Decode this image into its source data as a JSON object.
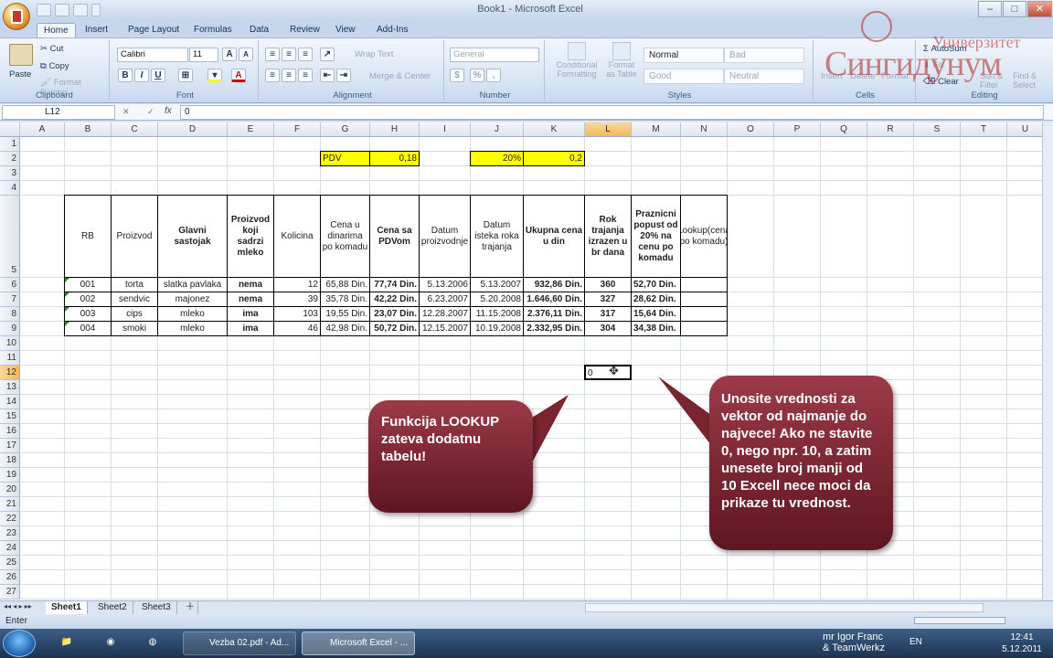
{
  "window": {
    "title": "Book1 - Microsoft Excel"
  },
  "tabs": [
    "Home",
    "Insert",
    "Page Layout",
    "Formulas",
    "Data",
    "Review",
    "View",
    "Add-Ins"
  ],
  "ribbon": {
    "clipboard": {
      "paste": "Paste",
      "cut": "Cut",
      "copy": "Copy",
      "format_painter": "Format Painter",
      "label": "Clipboard"
    },
    "font": {
      "name": "Calibri",
      "size": "11",
      "label": "Font",
      "bold": "B",
      "italic": "I",
      "underline": "U"
    },
    "alignment": {
      "wrap": "Wrap Text",
      "merge": "Merge & Center",
      "label": "Alignment"
    },
    "number": {
      "format": "General",
      "pct": "%",
      "comma": ",",
      "label": "Number"
    },
    "styles": {
      "cond": "Conditional Formatting",
      "table": "Format as Table",
      "normal": "Normal",
      "bad": "Bad",
      "good": "Good",
      "neutral": "Neutral",
      "label": "Styles"
    },
    "cells": {
      "insert": "Insert",
      "delete": "Delete",
      "format": "Format",
      "label": "Cells"
    },
    "editing": {
      "autosum": "AutoSum",
      "fill": "Fill",
      "clear": "Clear",
      "sort": "Sort & Filter",
      "find": "Find & Select",
      "label": "Editing"
    }
  },
  "formula_bar": {
    "name_box": "L12",
    "fx": "fx",
    "content": "0"
  },
  "columns": [
    "A",
    "B",
    "C",
    "D",
    "E",
    "F",
    "G",
    "H",
    "I",
    "J",
    "K",
    "L",
    "M",
    "N",
    "O",
    "P",
    "Q",
    "R",
    "S",
    "T",
    "U"
  ],
  "rows": [
    "1",
    "2",
    "3",
    "4",
    "5",
    "6",
    "7",
    "8",
    "9",
    "10",
    "11",
    "12",
    "13",
    "14",
    "15",
    "16",
    "17",
    "18",
    "19",
    "20",
    "21",
    "22",
    "23",
    "24",
    "25",
    "26",
    "27"
  ],
  "pdv": {
    "label": "PDV",
    "value": "0,18",
    "pct": "20%",
    "pct_value": "0,2"
  },
  "table": {
    "headers": [
      "RB",
      "Proizvod",
      "Glavni sastojak",
      "Proizvod koji sadrzi mleko",
      "Kolicina",
      "Cena u dinarima po komadu",
      "Cena sa PDVom",
      "Datum proizvodnje",
      "Datum isteka roka trajanja",
      "Ukupna cena u din",
      "Rok trajanja izrazen u br dana",
      "Praznicni popust od 20% na cenu po komadu",
      "Lookup(cena po komadu)"
    ],
    "rows": [
      [
        "001",
        "torta",
        "slatka pavlaka",
        "nema",
        "12",
        "65,88 Din.",
        "77,74 Din.",
        "5.13.2006",
        "5.13.2007",
        "932,86 Din.",
        "360",
        "52,70 Din.",
        ""
      ],
      [
        "002",
        "sendvic",
        "majonez",
        "nema",
        "39",
        "35,78 Din.",
        "42,22 Din.",
        "6.23.2007",
        "5.20.2008",
        "1.646,60 Din.",
        "327",
        "28,62 Din.",
        ""
      ],
      [
        "003",
        "cips",
        "mleko",
        "ima",
        "103",
        "19,55 Din.",
        "23,07 Din.",
        "12.28.2007",
        "11.15.2008",
        "2.376,11 Din.",
        "317",
        "15,64 Din.",
        ""
      ],
      [
        "004",
        "smoki",
        "mleko",
        "ima",
        "46",
        "42,98 Din.",
        "50,72 Din.",
        "12.15.2007",
        "10.19.2008",
        "2.332,95 Din.",
        "304",
        "34,38 Din.",
        ""
      ]
    ]
  },
  "active_cell_value": "0",
  "callouts": {
    "left": "Funkcija LOOKUP zateva dodatnu tabelu!",
    "right": "Unosite vrednosti za vektor od najmanje do najvece! Ako ne stavite 0, nego npr. 10, a zatim unesete broj manji od 10 Excell nece moci da prikaze tu vrednost."
  },
  "sheets": [
    "Sheet1",
    "Sheet2",
    "Sheet3"
  ],
  "status": "Enter",
  "watermark": {
    "line1": "Универзитет",
    "line2": "Сингидунум"
  },
  "taskbar": {
    "items": [
      "Vezba 02.pdf - Ad...",
      "Microsoft Excel - ..."
    ],
    "lang": "EN",
    "time": "12:41",
    "date": "5.12.2011",
    "credit1": "mr Igor Franc",
    "credit2": "& TeamWerkz"
  },
  "colors": {
    "accent": "#8b2a36",
    "highlight": "#ffff00"
  }
}
